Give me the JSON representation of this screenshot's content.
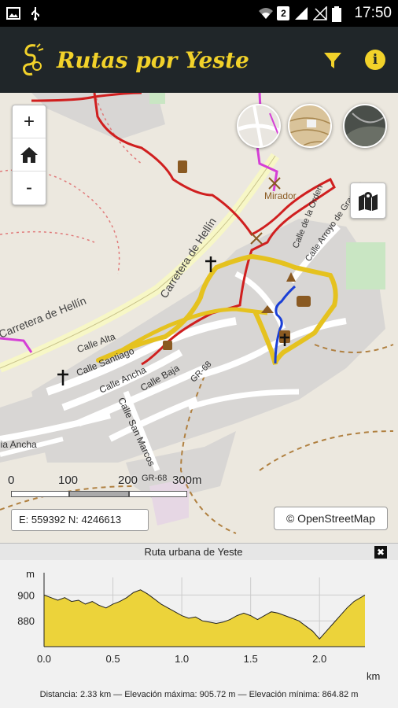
{
  "statusbar": {
    "sim_slot": "2",
    "time": "17:50"
  },
  "app": {
    "title": "Rutas por Yeste",
    "accent_color": "#f2d22a",
    "bar_color": "#202629"
  },
  "map": {
    "zoom_in": "+",
    "zoom_out": "-",
    "home_icon": "home-icon",
    "scale_labels": [
      "0",
      "100",
      "200",
      "300m"
    ],
    "coords": "E: 559392 N: 4246613",
    "attribution": "© OpenStreetMap",
    "street_labels": [
      "Carretera de Hellín",
      "Carretera de Hellín",
      "Calle Alta",
      "Calle Santiago",
      "Calle Ancha",
      "Calle Baja",
      "Calle San Marcos",
      "GR-68",
      "GR-68",
      "Calle Arroyo de Granedo",
      "Calle de la Orden",
      "Mirador",
      "lia Ancha"
    ],
    "route_colors": {
      "red": "#d01f1f",
      "yellow": "#e5c21f",
      "blue": "#1a3fd6",
      "magenta": "#d53fd6"
    }
  },
  "profile": {
    "title": "Ruta urbana de Yeste",
    "close": "✖",
    "y_unit": "m",
    "x_unit": "km",
    "footer": "Distancia: 2.33 km — Elevación máxima: 905.72 m — Elevación mínima: 864.82 m"
  },
  "chart_data": {
    "type": "area",
    "title": "Ruta urbana de Yeste",
    "xlabel": "km",
    "ylabel": "m",
    "xlim": [
      0,
      2.33
    ],
    "ylim": [
      860,
      910
    ],
    "xticks": [
      "0.0",
      "0.5",
      "1.0",
      "1.5",
      "2.0"
    ],
    "yticks": [
      "900",
      "880"
    ],
    "series": [
      {
        "x": [
          0,
          0.05,
          0.1,
          0.15,
          0.2,
          0.25,
          0.3,
          0.35,
          0.4,
          0.45,
          0.5,
          0.55,
          0.6,
          0.65,
          0.7,
          0.75,
          0.8,
          0.85,
          0.9,
          0.95,
          1.0,
          1.05,
          1.1,
          1.15,
          1.2,
          1.25,
          1.3,
          1.35,
          1.4,
          1.45,
          1.5,
          1.55,
          1.6,
          1.65,
          1.7,
          1.75,
          1.8,
          1.85,
          1.9,
          1.95,
          2.0,
          2.05,
          2.1,
          2.15,
          2.2,
          2.25,
          2.33
        ],
        "values": [
          900,
          898,
          896,
          898,
          895,
          896,
          893,
          895,
          892,
          890,
          893,
          895,
          898,
          902,
          904,
          901,
          897,
          893,
          890,
          887,
          884,
          882,
          883,
          880,
          879,
          878,
          879,
          881,
          884,
          886,
          884,
          881,
          884,
          887,
          886,
          884,
          882,
          880,
          876,
          872,
          866,
          872,
          878,
          884,
          890,
          895,
          900
        ]
      }
    ],
    "fill_color": "#ecd33a",
    "grid": true
  }
}
